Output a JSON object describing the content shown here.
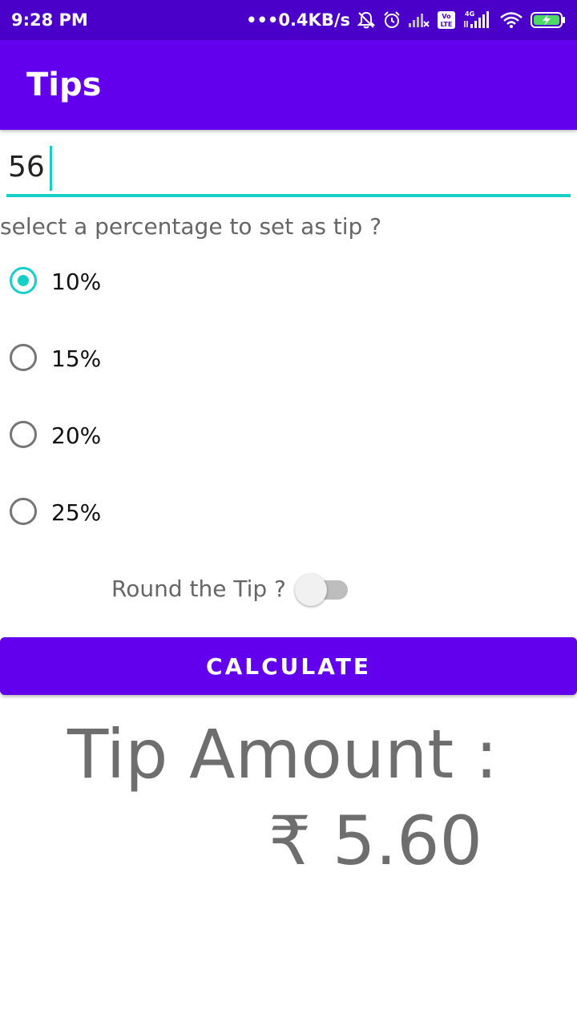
{
  "status_bar": {
    "time": "9:28 PM",
    "network_speed": "•••0.4KB/s",
    "icons": [
      "bell-off-icon",
      "alarm-icon",
      "signal-no-service-icon",
      "volte-icon",
      "4g-signal-icon",
      "wifi-icon",
      "battery-charging-icon"
    ],
    "volte_label": "Vo LTE",
    "network_type": "4G"
  },
  "app_bar": {
    "title": "Tips",
    "color": "#6200ee"
  },
  "amount_input": {
    "value": "56"
  },
  "prompt": "select a percentage to set as tip ?",
  "percentages": {
    "options": [
      {
        "label": "10%",
        "checked": true
      },
      {
        "label": "15%",
        "checked": false
      },
      {
        "label": "20%",
        "checked": false
      },
      {
        "label": "25%",
        "checked": false
      }
    ]
  },
  "round_tip": {
    "label": "Round the Tip ?",
    "enabled": false
  },
  "calculate_button": {
    "label": "CALCULATE"
  },
  "result": {
    "label": "Tip Amount :",
    "amount": "₹ 5.60"
  },
  "colors": {
    "primary": "#6200ee",
    "status_bar": "#4a00c8",
    "accent": "#16d0c8"
  }
}
